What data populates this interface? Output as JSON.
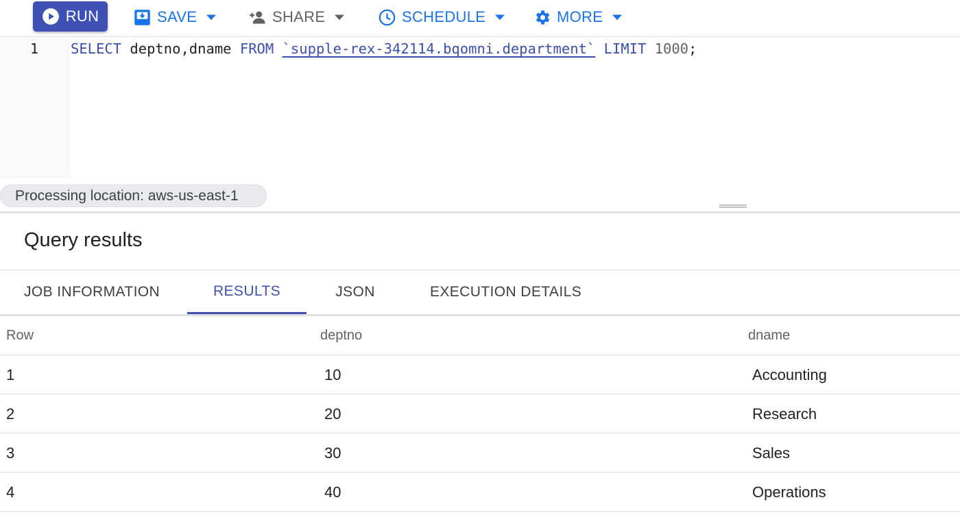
{
  "toolbar": {
    "run_label": "RUN",
    "save_label": "SAVE",
    "share_label": "SHARE",
    "schedule_label": "SCHEDULE",
    "more_label": "MORE"
  },
  "editor": {
    "line_number": "1",
    "query": {
      "kw_select": "SELECT",
      "columns": " deptno,dname ",
      "kw_from": "FROM",
      "space1": " ",
      "table": "`supple-rex-342114.bqomni.department`",
      "space2": " ",
      "kw_limit": "LIMIT",
      "limit_value": " 1000",
      "terminator": ";"
    }
  },
  "processing_location": "Processing location: aws-us-east-1",
  "results": {
    "title": "Query results",
    "tabs": [
      {
        "label": "JOB INFORMATION",
        "active": false
      },
      {
        "label": "RESULTS",
        "active": true
      },
      {
        "label": "JSON",
        "active": false
      },
      {
        "label": "EXECUTION DETAILS",
        "active": false
      }
    ],
    "columns": [
      "Row",
      "deptno",
      "dname"
    ],
    "rows": [
      [
        "1",
        "10",
        "Accounting"
      ],
      [
        "2",
        "20",
        "Research"
      ],
      [
        "3",
        "30",
        "Sales"
      ],
      [
        "4",
        "40",
        "Operations"
      ]
    ]
  },
  "icons": {
    "run": "play-circle-icon",
    "save": "save-icon",
    "share": "person-add-icon",
    "schedule": "clock-icon",
    "more": "gear-icon",
    "dropdown": "caret-down-icon"
  },
  "colors": {
    "run_button": "#3f51b5",
    "accent_blue": "#1a73e8",
    "sql_keyword": "#3b4fae",
    "active_tab": "#3f51b5"
  }
}
